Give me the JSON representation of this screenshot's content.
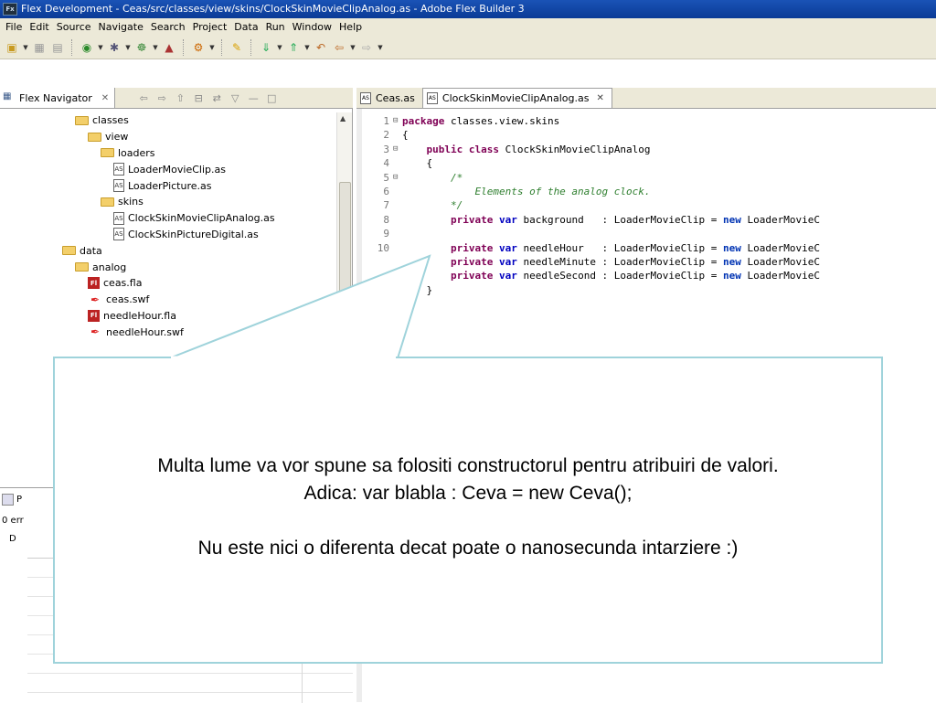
{
  "window": {
    "title": "Flex Development - Ceas/src/classes/view/skins/ClockSkinMovieClipAnalog.as - Adobe Flex Builder 3",
    "app_icon": "Fx"
  },
  "menu": [
    "File",
    "Edit",
    "Source",
    "Navigate",
    "Search",
    "Project",
    "Data",
    "Run",
    "Window",
    "Help"
  ],
  "navigator": {
    "tab_label": "Flex Navigator",
    "tree": [
      {
        "label": "classes",
        "type": "folder",
        "indent": 0
      },
      {
        "label": "view",
        "type": "folder",
        "indent": 1
      },
      {
        "label": "loaders",
        "type": "folder",
        "indent": 2
      },
      {
        "label": "LoaderMovieClip.as",
        "type": "as",
        "indent": 3
      },
      {
        "label": "LoaderPicture.as",
        "type": "as",
        "indent": 3
      },
      {
        "label": "skins",
        "type": "folder",
        "indent": 2
      },
      {
        "label": "ClockSkinMovieClipAnalog.as",
        "type": "as",
        "indent": 3
      },
      {
        "label": "ClockSkinPictureDigital.as",
        "type": "as",
        "indent": 3
      },
      {
        "label": "data",
        "type": "folder",
        "indent": -1
      },
      {
        "label": "analog",
        "type": "folder",
        "indent": 0
      },
      {
        "label": "ceas.fla",
        "type": "fla",
        "indent": 1
      },
      {
        "label": "ceas.swf",
        "type": "swf",
        "indent": 1
      },
      {
        "label": "needleHour.fla",
        "type": "fla",
        "indent": 1
      },
      {
        "label": "needleHour.swf",
        "type": "swf",
        "indent": 1
      }
    ]
  },
  "problems": {
    "tab_label": "P",
    "count_label": "0 err",
    "header": "D"
  },
  "editor": {
    "tabs": [
      {
        "label": "Ceas.as",
        "active": false
      },
      {
        "label": "ClockSkinMovieClipAnalog.as",
        "active": true
      }
    ],
    "lines": [
      {
        "n": "1",
        "fold": true,
        "parts": [
          [
            "kw1",
            "package"
          ],
          [
            "ct",
            " classes.view.skins"
          ]
        ]
      },
      {
        "n": "2",
        "fold": false,
        "parts": [
          [
            "ct",
            "{"
          ]
        ]
      },
      {
        "n": "3",
        "fold": true,
        "parts": [
          [
            "ct",
            "    "
          ],
          [
            "kw1",
            "public class"
          ],
          [
            "ct",
            " ClockSkinMovieClipAnalog"
          ]
        ]
      },
      {
        "n": "4",
        "fold": false,
        "parts": [
          [
            "ct",
            "    {"
          ]
        ]
      },
      {
        "n": "5",
        "fold": true,
        "parts": [
          [
            "cmt",
            "        /*"
          ]
        ]
      },
      {
        "n": "6",
        "fold": false,
        "parts": [
          [
            "cmt",
            "            Elements of the analog clock."
          ]
        ]
      },
      {
        "n": "7",
        "fold": false,
        "parts": [
          [
            "cmt",
            "        */"
          ]
        ]
      },
      {
        "n": "8",
        "fold": false,
        "parts": [
          [
            "ct",
            "        "
          ],
          [
            "kw1",
            "private"
          ],
          [
            "ct",
            " "
          ],
          [
            "kw2",
            "var"
          ],
          [
            "ct",
            " background   : LoaderMovieClip = "
          ],
          [
            "kw3",
            "new"
          ],
          [
            "ct",
            " LoaderMovieC"
          ]
        ]
      },
      {
        "n": "9",
        "fold": false,
        "parts": [
          [
            "ct",
            ""
          ]
        ]
      },
      {
        "n": "10",
        "fold": false,
        "parts": [
          [
            "ct",
            "        "
          ],
          [
            "kw1",
            "private"
          ],
          [
            "ct",
            " "
          ],
          [
            "kw2",
            "var"
          ],
          [
            "ct",
            " needleHour   : LoaderMovieClip = "
          ],
          [
            "kw3",
            "new"
          ],
          [
            "ct",
            " LoaderMovieC"
          ]
        ]
      },
      {
        "n": "",
        "fold": false,
        "parts": [
          [
            "ct",
            "        "
          ],
          [
            "kw1",
            "private"
          ],
          [
            "ct",
            " "
          ],
          [
            "kw2",
            "var"
          ],
          [
            "ct",
            " needleMinute : LoaderMovieClip = "
          ],
          [
            "kw3",
            "new"
          ],
          [
            "ct",
            " LoaderMovieC"
          ]
        ]
      },
      {
        "n": "",
        "fold": false,
        "parts": [
          [
            "ct",
            "        "
          ],
          [
            "kw1",
            "private"
          ],
          [
            "ct",
            " "
          ],
          [
            "kw2",
            "var"
          ],
          [
            "ct",
            " needleSecond : LoaderMovieClip = "
          ],
          [
            "kw3",
            "new"
          ],
          [
            "ct",
            " LoaderMovieC"
          ]
        ]
      },
      {
        "n": "",
        "fold": false,
        "parts": [
          [
            "ct",
            "    }"
          ]
        ]
      }
    ]
  },
  "callout": {
    "line1": "Multa lume va vor spune sa folositi constructorul pentru atribuiri de valori.",
    "line2": "Adica: var blabla : Ceva = new Ceva();",
    "line3": "Nu este nici o diferenta decat poate o nanosecunda intarziere :)",
    "border_color": "#9fd3db"
  }
}
